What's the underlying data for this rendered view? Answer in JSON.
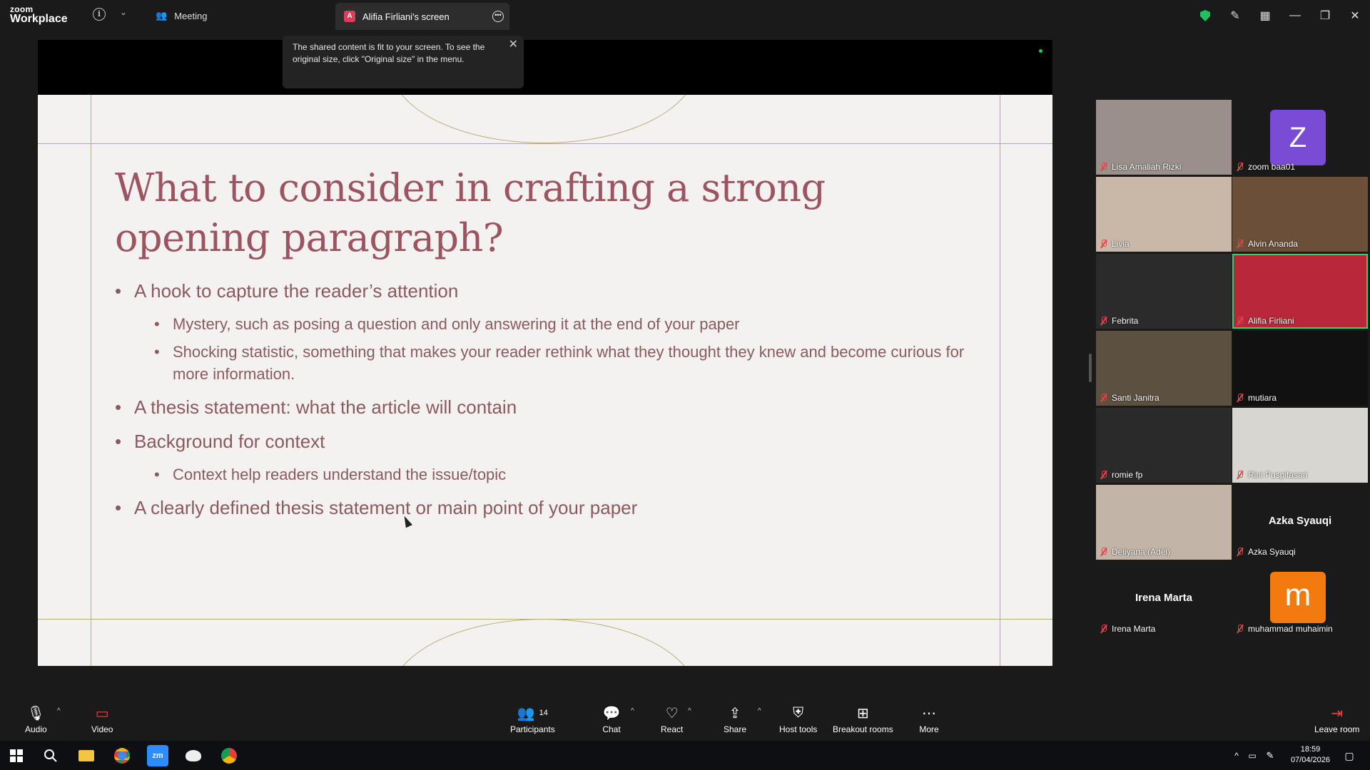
{
  "app": {
    "brand_top": "zoom",
    "brand_bottom": "Workplace",
    "meeting_label": "Meeting",
    "share_tab_label": "Alifia Firliani's screen",
    "share_tab_initial": "A"
  },
  "tooltip": {
    "text": "The shared content is fit to your screen. To see the original size, click \"Original size\" in the menu.",
    "close": "✕"
  },
  "slide": {
    "title": "What to consider in crafting a strong opening paragraph?",
    "bullets": [
      {
        "text": "A hook to capture the reader’s attention",
        "sub": [
          "Mystery, such as posing a question and only answering it at the end of your paper",
          "Shocking statistic, something that makes your reader rethink what they thought they knew and become curious for more information."
        ]
      },
      {
        "text": "A thesis statement: what the article will contain",
        "sub": []
      },
      {
        "text": "Background for context",
        "sub": [
          "Context help readers understand the issue/topic"
        ]
      },
      {
        "text": "A clearly defined thesis statement or main point of your paper",
        "sub": []
      }
    ]
  },
  "participants_gallery": [
    {
      "name": "Lisa Amaliah Rizki",
      "type": "video",
      "bg": "#9a8f8a"
    },
    {
      "name": "zoom baa01",
      "type": "avatar",
      "initial": "Z",
      "color": "#7a4bd4"
    },
    {
      "name": "Livia",
      "type": "video",
      "bg": "#c9b8a8"
    },
    {
      "name": "Alvin Ananda",
      "type": "video",
      "bg": "#6b4f38"
    },
    {
      "name": "Febrita",
      "type": "video",
      "bg": "#2b2b2b"
    },
    {
      "name": "Alifia Firliani",
      "type": "video",
      "bg": "#b8283a",
      "active": true
    },
    {
      "name": "Santi Janitra",
      "type": "video",
      "bg": "#5c5040"
    },
    {
      "name": "mutiara",
      "type": "video",
      "bg": "#111111"
    },
    {
      "name": "romie fp",
      "type": "video",
      "bg": "#2a2a2a"
    },
    {
      "name": "Rini Puspitasari",
      "type": "video",
      "bg": "#d8d6d0"
    },
    {
      "name": "Deliyana (Adel)",
      "type": "video",
      "bg": "#c2b4a6"
    },
    {
      "name": "Azka Syauqi",
      "type": "name",
      "display": "Azka Syauqi"
    },
    {
      "name": "Irena Marta",
      "type": "name",
      "display": "Irena Marta"
    },
    {
      "name": "muhammad muhaimin",
      "type": "avatar",
      "initial": "m",
      "color": "#f27a0e"
    }
  ],
  "toolbar": {
    "audio": "Audio",
    "video": "Video",
    "participants": "Participants",
    "participants_count": "14",
    "chat": "Chat",
    "react": "React",
    "share": "Share",
    "host_tools": "Host tools",
    "breakout_rooms": "Breakout rooms",
    "more": "More",
    "leave_room": "Leave room"
  },
  "taskbar": {
    "time": "18:59",
    "date": "07/04/2026"
  },
  "colors": {
    "accent_green": "#2ed46a",
    "mute_red": "#e0464b",
    "slide_title": "#9c5560",
    "slide_text": "#8a5a5e"
  }
}
